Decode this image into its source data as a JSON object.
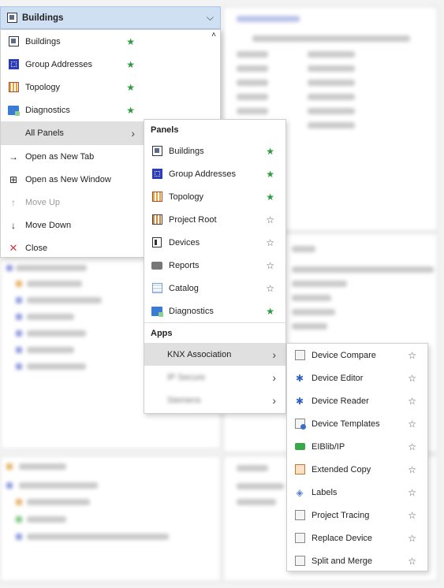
{
  "header": {
    "title": "Buildings"
  },
  "main_menu": {
    "items": [
      {
        "label": "Buildings",
        "icon": "buildings-icon",
        "favorite": true
      },
      {
        "label": "Group Addresses",
        "icon": "group-addresses-icon",
        "favorite": true
      },
      {
        "label": "Topology",
        "icon": "topology-icon",
        "favorite": true
      },
      {
        "label": "Diagnostics",
        "icon": "diagnostics-icon",
        "favorite": true
      },
      {
        "label": "All Panels",
        "icon": "",
        "submenu": true
      },
      {
        "label": "Open as New Tab",
        "icon": "arrow-right-icon"
      },
      {
        "label": "Open as New Window",
        "icon": "new-window-icon"
      },
      {
        "label": "Move Up",
        "icon": "arrow-up-icon",
        "disabled": true
      },
      {
        "label": "Move Down",
        "icon": "arrow-down-icon"
      },
      {
        "label": "Close",
        "icon": "close-icon"
      }
    ]
  },
  "panels_menu": {
    "panels_header": "Panels",
    "items": [
      {
        "label": "Buildings",
        "icon": "buildings-icon",
        "favorite": true
      },
      {
        "label": "Group Addresses",
        "icon": "group-addresses-icon",
        "favorite": true
      },
      {
        "label": "Topology",
        "icon": "topology-icon",
        "favorite": true
      },
      {
        "label": "Project Root",
        "icon": "project-root-icon",
        "favorite": false
      },
      {
        "label": "Devices",
        "icon": "devices-icon",
        "favorite": false
      },
      {
        "label": "Reports",
        "icon": "reports-icon",
        "favorite": false
      },
      {
        "label": "Catalog",
        "icon": "catalog-icon",
        "favorite": false
      },
      {
        "label": "Diagnostics",
        "icon": "diagnostics-icon",
        "favorite": true
      }
    ],
    "apps_header": "Apps",
    "apps": [
      {
        "label": "KNX Association",
        "submenu": true
      },
      {
        "label": "IP Secure",
        "submenu": true,
        "blurred": true
      },
      {
        "label": "Siemens",
        "submenu": true,
        "blurred": true
      }
    ]
  },
  "apps_menu": {
    "items": [
      {
        "label": "Device Compare",
        "icon": "device-compare-icon"
      },
      {
        "label": "Device Editor",
        "icon": "puzzle-icon"
      },
      {
        "label": "Device Reader",
        "icon": "puzzle-icon"
      },
      {
        "label": "Device Templates",
        "icon": "device-templates-icon"
      },
      {
        "label": "EIBlib/IP",
        "icon": "eiblib-icon"
      },
      {
        "label": "Extended Copy",
        "icon": "extended-copy-icon"
      },
      {
        "label": "Labels",
        "icon": "tag-icon"
      },
      {
        "label": "Project Tracing",
        "icon": "project-tracing-icon"
      },
      {
        "label": "Replace Device",
        "icon": "replace-device-icon"
      },
      {
        "label": "Split and Merge",
        "icon": "split-merge-icon"
      }
    ]
  },
  "glyphs": {
    "star": "★",
    "star_outline": "☆",
    "chevron_right": "›",
    "chevron_down": "⌵"
  },
  "colors": {
    "favorite_star": "#2d9b3f",
    "header_bg": "#cfe0f3",
    "hover_bg": "#e0e0e0"
  }
}
